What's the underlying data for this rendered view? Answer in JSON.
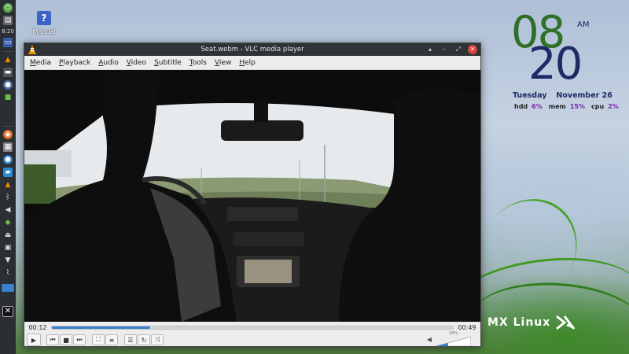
{
  "panel": {
    "clock": "8:20",
    "icons": [
      "power-icon",
      "notes-icon",
      "window-icon",
      "vlc-taskbar-icon",
      "terminal-icon",
      "settings-icon",
      "package-icon",
      "firefox-icon",
      "files-icon",
      "thunderbird-icon",
      "chat-icon",
      "vlc-icon",
      "bluetooth-icon",
      "volume-icon",
      "update-icon",
      "eject-icon",
      "lock-icon",
      "network-icon",
      "clip-icon",
      "workspace-icon",
      "mx-menu-icon"
    ]
  },
  "desktop": {
    "manual_label": "Manual",
    "logo_text": "MX Linux"
  },
  "conky": {
    "hour": "08",
    "minute": "20",
    "ampm": "AM",
    "weekday": "Tuesday",
    "date": "November 26",
    "hdd_label": "hdd",
    "hdd_value": "6%",
    "mem_label": "mem",
    "mem_value": "15%",
    "cpu_label": "cpu",
    "cpu_value": "2%"
  },
  "vlc": {
    "title": "Seat.webm - VLC media player",
    "menu": [
      {
        "label": "Media",
        "key": "M",
        "rest": "edia"
      },
      {
        "label": "Playback",
        "key": "P",
        "rest": "layback"
      },
      {
        "label": "Audio",
        "key": "A",
        "rest": "udio"
      },
      {
        "label": "Video",
        "key": "V",
        "rest": "ideo"
      },
      {
        "label": "Subtitle",
        "key": "S",
        "rest": "ubtitle"
      },
      {
        "label": "Tools",
        "key": "T",
        "rest": "ools"
      },
      {
        "label": "View",
        "key": "V",
        "rest": "iew"
      },
      {
        "label": "Help",
        "key": "H",
        "rest": "elp"
      }
    ],
    "elapsed": "00:12",
    "duration": "00:49",
    "progress": 0.245,
    "volume_label": "34%",
    "volume": 0.34,
    "accent": "#3a7fd0"
  }
}
